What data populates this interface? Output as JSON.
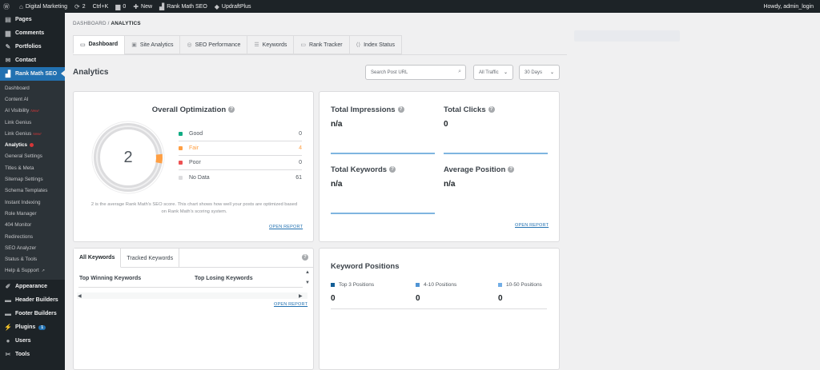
{
  "admin_bar": {
    "site_name": "Digital Marketing",
    "updates_count": "2",
    "shortcut": "Ctrl+K",
    "comments_count": "0",
    "new_label": "New",
    "rank_math_label": "Rank Math SEO",
    "updraft_label": "UpdraftPlus",
    "howdy": "Howdy, admin_login"
  },
  "sidebar": {
    "top_items": [
      {
        "label": "Pages",
        "icon": "pages-icon"
      },
      {
        "label": "Comments",
        "icon": "comments-icon"
      },
      {
        "label": "Portfolios",
        "icon": "portfolio-icon"
      },
      {
        "label": "Contact",
        "icon": "envelope-icon"
      }
    ],
    "active_item": {
      "label": "Rank Math SEO",
      "icon": "rank-math-icon"
    },
    "submenu": [
      {
        "label": "Dashboard"
      },
      {
        "label": "Content AI"
      },
      {
        "label": "AI Visibility",
        "tag": "New!"
      },
      {
        "label": "Link Genius"
      },
      {
        "label": "Link Genius",
        "tag": "New!"
      },
      {
        "label": "Analytics"
      },
      {
        "label": "General Settings"
      },
      {
        "label": "Titles & Meta"
      },
      {
        "label": "Sitemap Settings"
      },
      {
        "label": "Schema Templates"
      },
      {
        "label": "Instant Indexing"
      },
      {
        "label": "Role Manager"
      },
      {
        "label": "404 Monitor"
      },
      {
        "label": "Redirections"
      },
      {
        "label": "SEO Analyzer"
      },
      {
        "label": "Status & Tools"
      },
      {
        "label": "Help & Support"
      }
    ],
    "bottom_items": [
      {
        "label": "Appearance",
        "icon": "paintbrush-icon"
      },
      {
        "label": "Header Builders",
        "icon": "header-icon"
      },
      {
        "label": "Footer Builders",
        "icon": "footer-icon"
      },
      {
        "label": "Plugins",
        "icon": "plugin-icon",
        "badge": "1"
      },
      {
        "label": "Users",
        "icon": "users-icon"
      },
      {
        "label": "Tools",
        "icon": "wrench-icon"
      }
    ]
  },
  "breadcrumb": {
    "parent": "DASHBOARD",
    "separator": "/",
    "current": "ANALYTICS"
  },
  "tabs": [
    {
      "label": "Dashboard",
      "icon": "monitor-icon"
    },
    {
      "label": "Site Analytics",
      "icon": "chart-icon"
    },
    {
      "label": "SEO Performance",
      "icon": "gauge-icon"
    },
    {
      "label": "Keywords",
      "icon": "list-icon"
    },
    {
      "label": "Rank Tracker",
      "icon": "monitor-icon"
    },
    {
      "label": "Index Status",
      "icon": "code-icon"
    }
  ],
  "page_title": "Analytics",
  "search": {
    "placeholder": "Search Post URL"
  },
  "traffic_select": {
    "value": "All Traffic"
  },
  "days_select": {
    "value": "30 Days"
  },
  "optimization": {
    "title": "Overall Optimization",
    "score": "2",
    "legend": [
      {
        "label": "Good",
        "value": "0",
        "color": "#10ac84"
      },
      {
        "label": "Fair",
        "value": "4",
        "color": "#ff9f43"
      },
      {
        "label": "Poor",
        "value": "0",
        "color": "#ee5253"
      },
      {
        "label": "No Data",
        "value": "61",
        "color": "#dcdcde"
      }
    ],
    "description": "2 is the average Rank Math's SEO score. This chart shows how well your posts are optimized based on Rank Math's scoring system.",
    "open_report": "OPEN REPORT"
  },
  "stats": {
    "impressions": {
      "label": "Total Impressions",
      "value": "n/a"
    },
    "clicks": {
      "label": "Total Clicks",
      "value": "0"
    },
    "keywords": {
      "label": "Total Keywords",
      "value": "n/a"
    },
    "position": {
      "label": "Average Position",
      "value": "n/a"
    },
    "open_report": "OPEN REPORT"
  },
  "keywords_card": {
    "tabs": [
      "All Keywords",
      "Tracked Keywords"
    ],
    "col_winning": "Top Winning Keywords",
    "col_losing": "Top Losing Keywords",
    "open_report": "OPEN REPORT"
  },
  "positions_card": {
    "title": "Keyword Positions",
    "items": [
      {
        "label": "Top 3 Positions",
        "value": "0",
        "color": "#135e96"
      },
      {
        "label": "4-10 Positions",
        "value": "0",
        "color": "#4f94d4"
      },
      {
        "label": "10-50 Positions",
        "value": "0",
        "color": "#72aee6"
      }
    ]
  }
}
